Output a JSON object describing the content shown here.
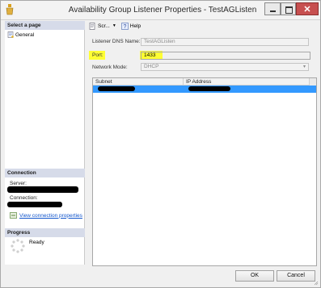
{
  "window": {
    "title": "Availability Group Listener Properties - TestAGListen",
    "close_glyph": "✕"
  },
  "left_pane": {
    "select_page_header": "Select a page",
    "pages": [
      {
        "label": "General",
        "icon": "page-icon"
      }
    ],
    "connection_header": "Connection",
    "server_label": "Server:",
    "connection_label": "Connection:",
    "view_connection_link": "View connection properties",
    "progress_header": "Progress",
    "progress_status": "Ready"
  },
  "toolbar": {
    "script_label": "Scr...",
    "script_caret": "▼",
    "help_label": "Help",
    "script_icon": "script-icon",
    "help_icon": "help-icon"
  },
  "form": {
    "dns_name_label": "Listener DNS Name:",
    "dns_name_value": "TestAGListen",
    "port_label": "Port:",
    "port_value": "1433",
    "network_mode_label": "Network Mode:",
    "network_mode_value": "DHCP",
    "highlight_color": "#ffff33"
  },
  "grid": {
    "columns": [
      "Subnet",
      "IP Address"
    ],
    "selected_row_color": "#3399ff"
  },
  "buttons": {
    "ok": "OK",
    "cancel": "Cancel"
  }
}
